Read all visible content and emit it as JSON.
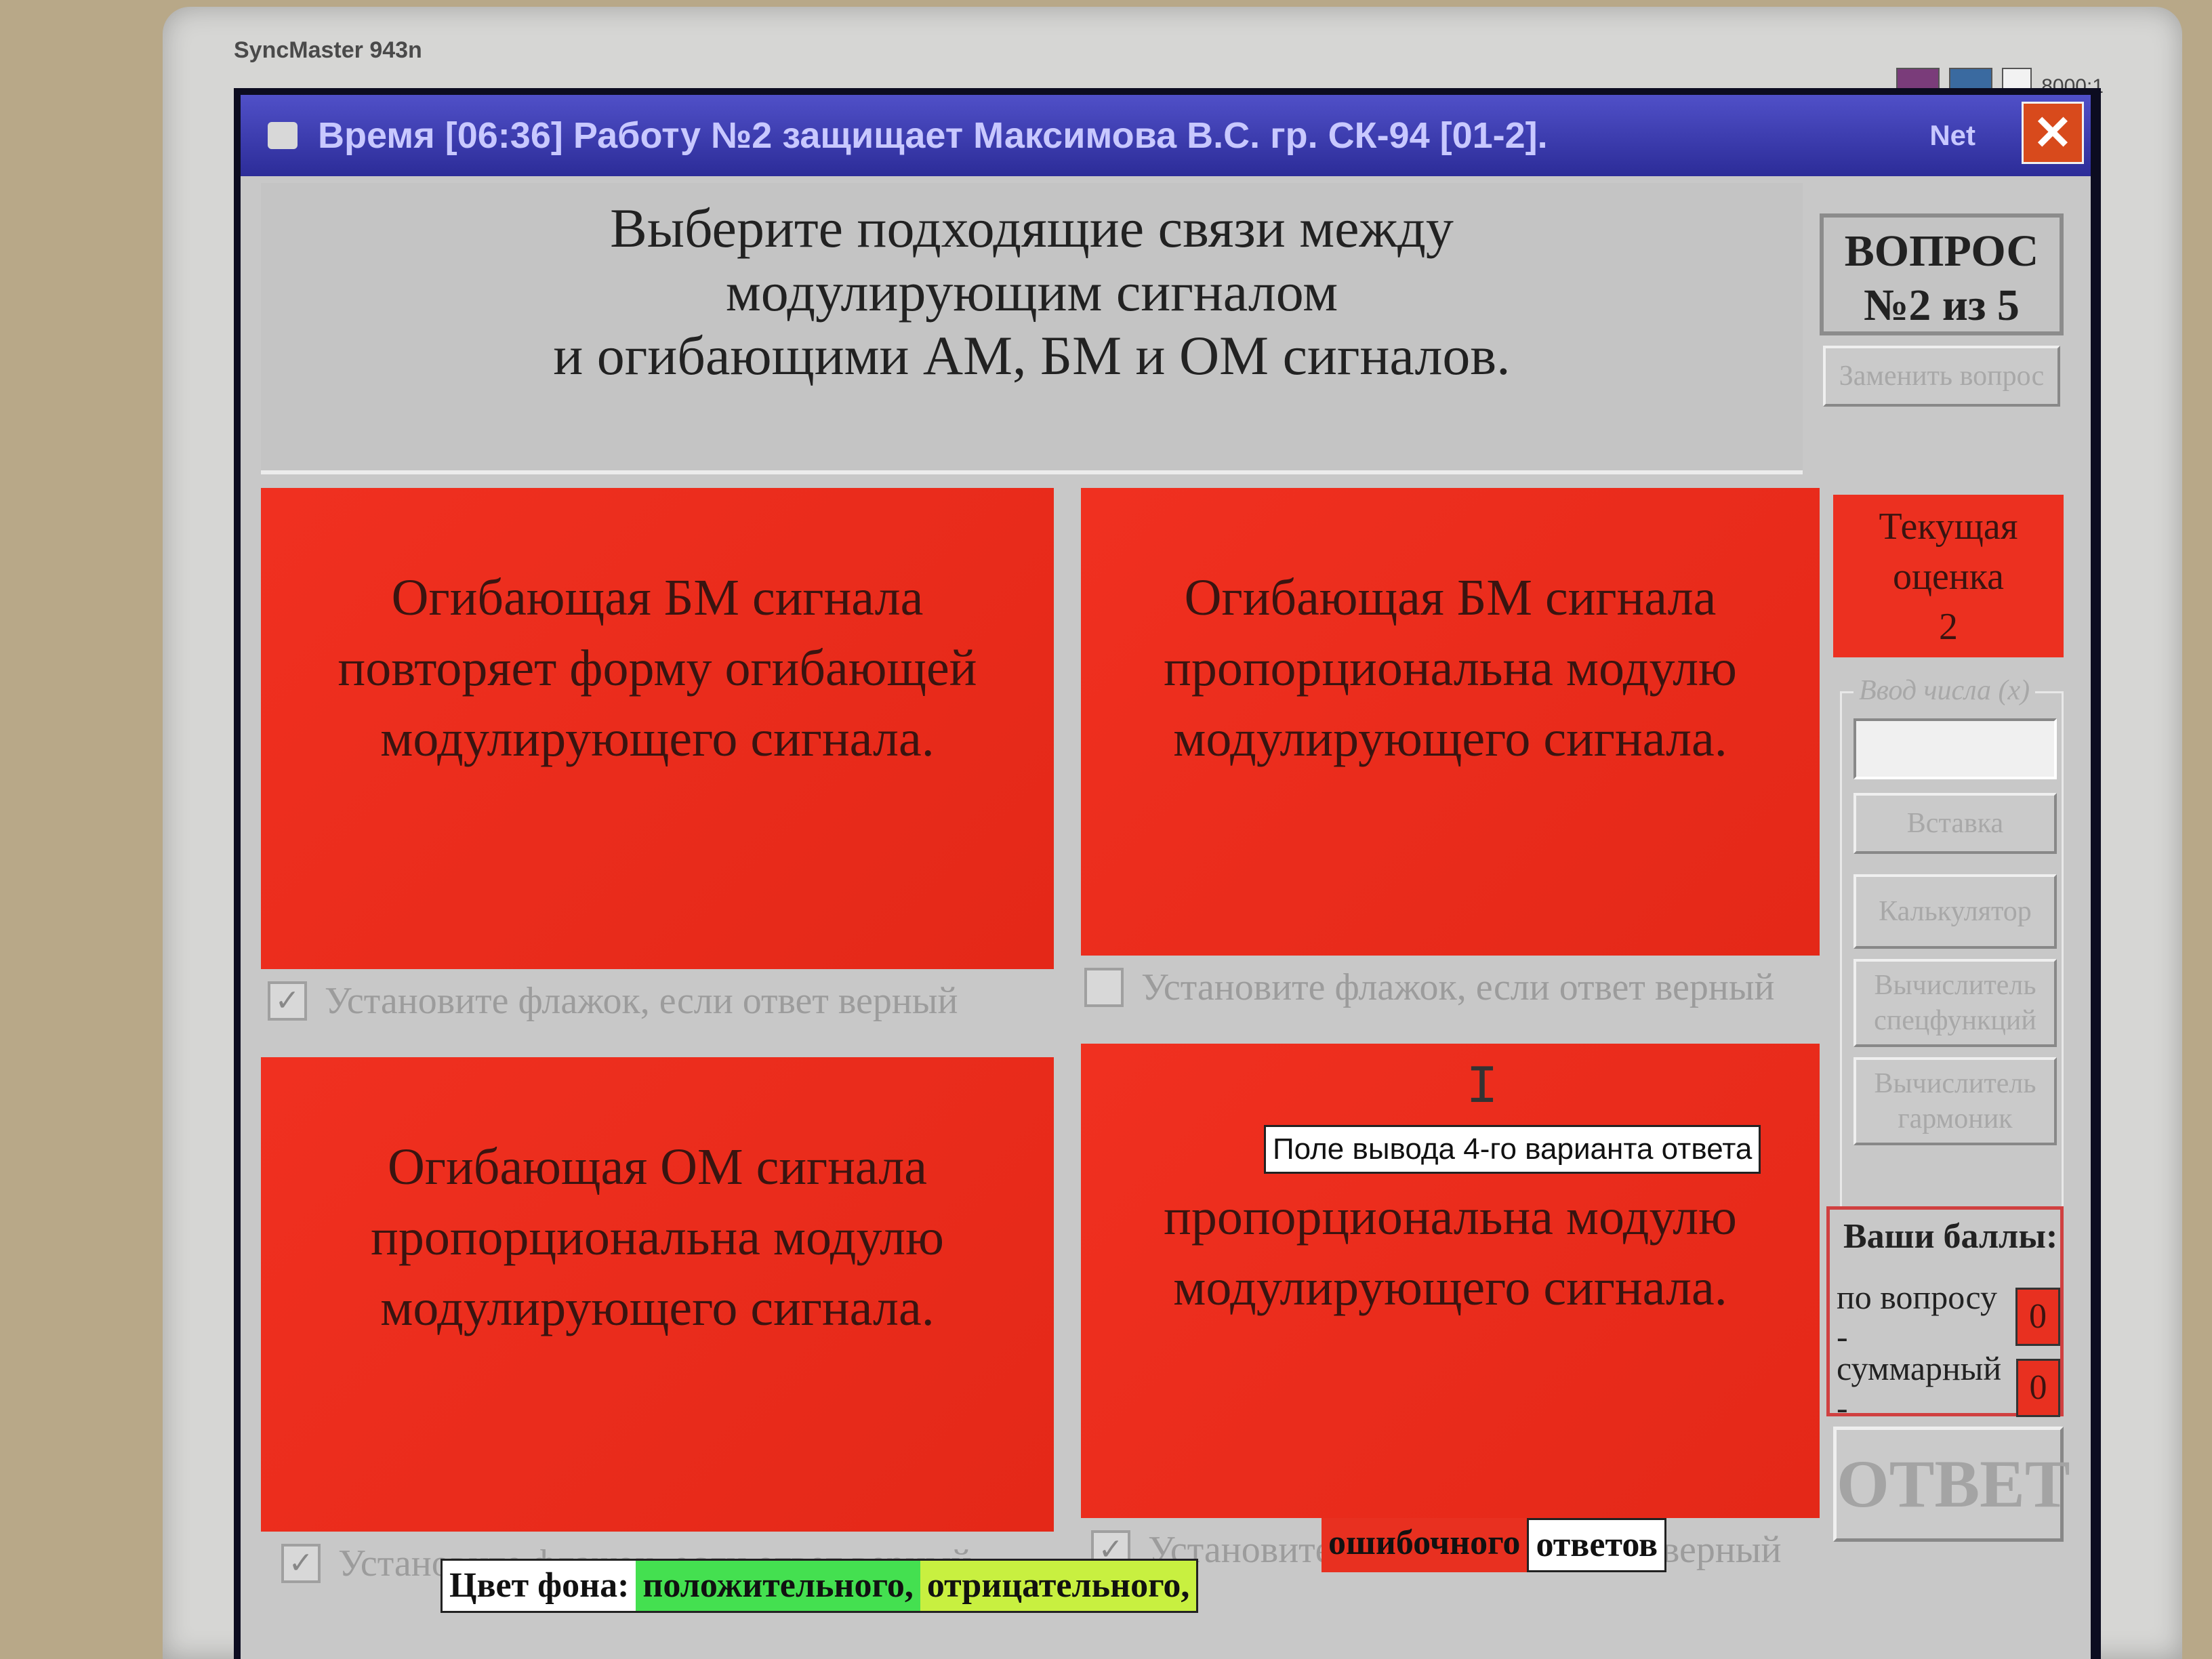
{
  "monitor": {
    "brand": "SyncMaster 943n",
    "contrast": "8000:1"
  },
  "window": {
    "title": "Время [06:36] Работу №2 защищает Максимова В.С.  гр. СК-94 [01-2].",
    "net_label": "Net",
    "close_glyph": "✕"
  },
  "question": {
    "text": "Выберите подходящие связи между\nмодулирующим сигналом\nи огибающими АМ, БМ и ОМ сигналов."
  },
  "answers": [
    {
      "text": "Огибающая БМ сигнала\nповторяет форму огибающей\nмодулирующего сигнала.",
      "checkbox_label": "Установите флажок, если ответ верный",
      "checked": true
    },
    {
      "text": "Огибающая БМ сигнала\nпропорциональна модулю\nмодулирующего сигнала.",
      "checkbox_label": "Установите флажок, если ответ верный",
      "checked": false
    },
    {
      "text": "Огибающая ОМ сигнала\nпропорциональна модулю\nмодулирующего сигнала.",
      "checkbox_label": "Установите флажок, если ответ верный",
      "checked": true
    },
    {
      "text": "Оги\nпропорциональна модулю\nмодулирующего сигнала.",
      "checkbox_label": "Установите флажок, если ответ верный",
      "checked": true
    }
  ],
  "tooltip": "Поле вывода 4-го варианта ответа",
  "checkmark_glyph": "✓",
  "sidebar": {
    "question_counter": "ВОПРОС\n№2 из 5",
    "replace_button": "Заменить вопрос",
    "grade_label": "Текущая\nоценка\n2",
    "input_legend": "Ввод числа (x)",
    "input_value": "",
    "insert_button": "Вставка",
    "calculator_button": "Калькулятор",
    "special_functions_button": "Вычислитель\nспецфункций",
    "harmonics_button": "Вычислитель\nгармоник",
    "scores_title": "Ваши баллы:",
    "score_question_label": "по вопросу -",
    "score_question_value": "0",
    "score_total_label": "суммарный -",
    "score_total_value": "0",
    "answer_button": "ОТВЕТ"
  },
  "legend": {
    "label": "Цвет фона:",
    "positive": "положительного,",
    "negative": "отрицательного,",
    "error": "ошибочного",
    "suffix": "ответов"
  },
  "colors": {
    "answer_bg": "#e42818",
    "title_bar": "#3a3ab0",
    "positive": "#44e050",
    "negative": "#c8f040",
    "error": "#e83020"
  }
}
